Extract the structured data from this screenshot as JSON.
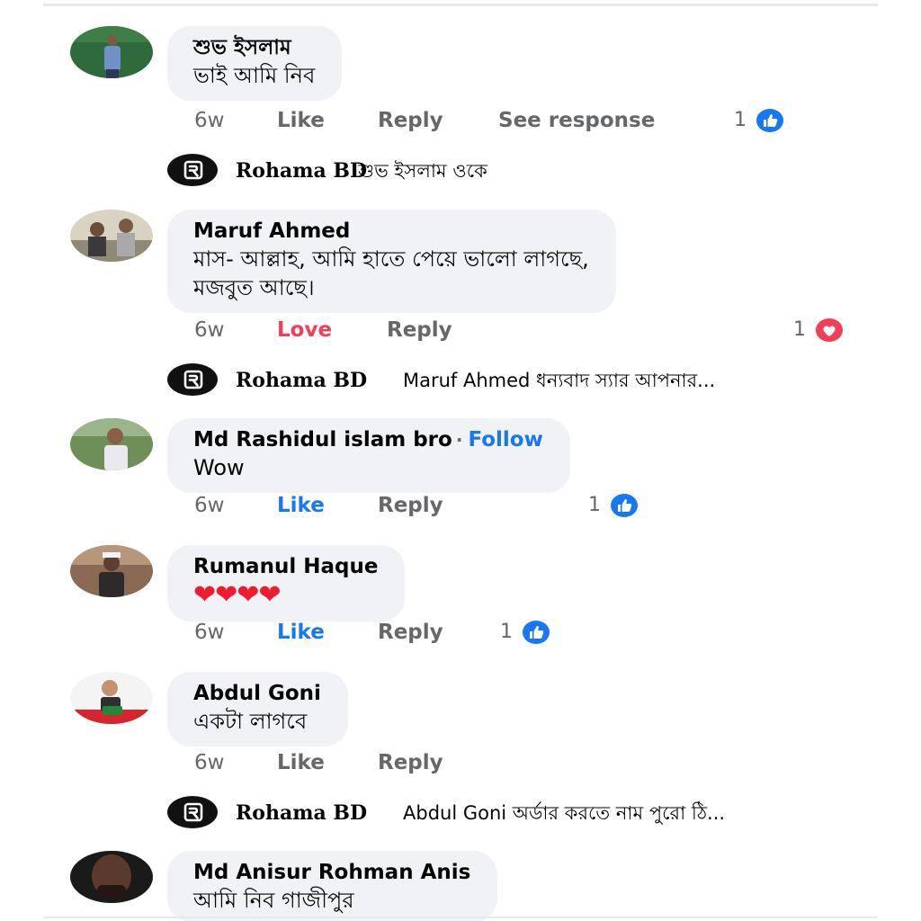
{
  "colors": {
    "bubble": "#f0f2f5",
    "meta_gray": "#65676b",
    "like_blue": "#1877f2",
    "love_red": "#f33e58"
  },
  "comments": [
    {
      "author": "শুভ ইসলাম",
      "text": "ভাই আমি  নিব",
      "time": "6w",
      "like": "Like",
      "reply": "Reply",
      "see_response": "See response",
      "reaction_count": "1",
      "reaction_icon": "like-icon",
      "reply_preview": {
        "name": "Rohama BD",
        "text": "শুভ ইসলাম ওকে"
      }
    },
    {
      "author": "Maruf Ahmed",
      "text_line1": "মাস- আল্লাহ, আমি হাতে পেয়ে ভালো লাগছে,",
      "text_line2": "মজবুত আছে।",
      "time": "6w",
      "reaction_label": "Love",
      "reply": "Reply",
      "reaction_count": "1",
      "reaction_icon": "love-icon",
      "reply_preview": {
        "name": "Rohama BD",
        "text": "Maruf Ahmed ধন্যবাদ স্যার আপনার..."
      }
    },
    {
      "author": "Md Rashidul islam bro",
      "separator": "·",
      "follow": "Follow",
      "text": "Wow",
      "time": "6w",
      "like": "Like",
      "reply": "Reply",
      "reaction_count": "1",
      "reaction_icon": "like-icon"
    },
    {
      "author": "Rumanul Haque",
      "text": "❤❤❤❤",
      "time": "6w",
      "like": "Like",
      "reply": "Reply",
      "reaction_count": "1",
      "reaction_icon": "like-icon"
    },
    {
      "author": "Abdul Goni",
      "text": "একটা লাগবে",
      "time": "6w",
      "like": "Like",
      "reply": "Reply",
      "reply_preview": {
        "name": "Rohama BD",
        "text": "Abdul Goni অর্ডার করতে নাম পুরো ঠি..."
      }
    },
    {
      "author": "Md Anisur Rohman Anis",
      "text": "আমি নিব গাজীপুর"
    }
  ]
}
